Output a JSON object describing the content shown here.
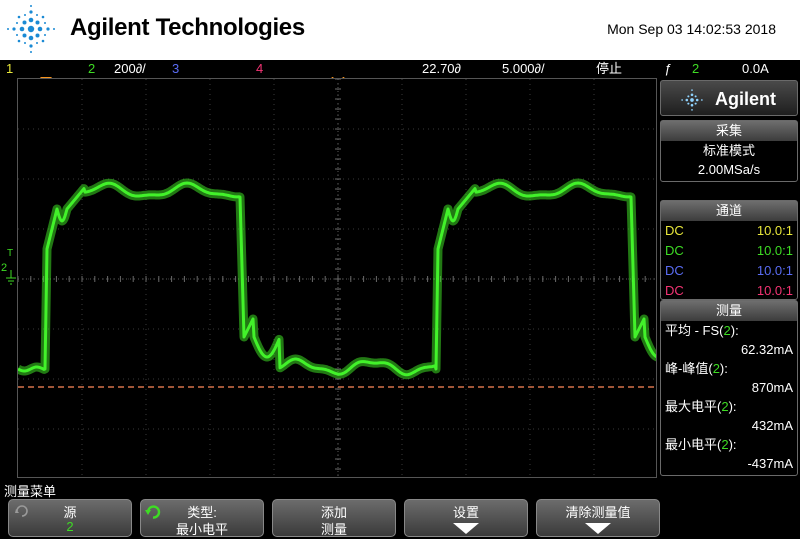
{
  "header": {
    "brand": "Agilent Technologies",
    "datetime": "Mon Sep 03 14:02:53 2018"
  },
  "statusbar": {
    "ch1": "1",
    "ch2": "2",
    "ch2_scale": "200",
    "ch2_scale_unit": "∂/",
    "ch3": "3",
    "ch4": "4",
    "time_offset": "22.70",
    "time_offset_unit": "∂",
    "time_scale": "5.000",
    "time_scale_unit": "∂/",
    "run_state": "停止",
    "trigger_symbol": "ƒ",
    "trigger_channel": "2",
    "trigger_level": "0.0A"
  },
  "colors": {
    "ch1": "#e8e83a",
    "ch2": "#3edc24",
    "ch3": "#5a6cf4",
    "ch4": "#f43474",
    "ground_ref": "#ff8a5a"
  },
  "panel": {
    "logo": "Agilent",
    "acquire": {
      "title": "采集",
      "mode": "标准模式",
      "rate": "2.00MSa/s"
    },
    "channels": {
      "title": "通道",
      "rows": [
        {
          "coupling": "DC",
          "probe": "10.0:1",
          "color": "#e8e83a"
        },
        {
          "coupling": "DC",
          "probe": "10.0:1",
          "color": "#3edc24"
        },
        {
          "coupling": "DC",
          "probe": "10.0:1",
          "color": "#5a6cf4"
        },
        {
          "coupling": "DC",
          "probe": "10.0:1",
          "color": "#f43474"
        }
      ]
    },
    "measure": {
      "title": "测量",
      "items": [
        {
          "label": "平均 - FS",
          "channel": "2",
          "value": "62.32mA"
        },
        {
          "label": "峰-峰值",
          "channel": "2",
          "value": "870mA"
        },
        {
          "label": "最大电平",
          "channel": "2",
          "value": "432mA"
        },
        {
          "label": "最小电平",
          "channel": "2",
          "value": "-437mA"
        }
      ]
    }
  },
  "menu": {
    "title": "测量菜单",
    "keys": [
      {
        "line1": "源",
        "line2": "2"
      },
      {
        "line1": "类型:",
        "line2": "最小电平"
      },
      {
        "line1": "添加",
        "line2": "测量"
      },
      {
        "line1": "设置",
        "line2": ""
      },
      {
        "line1": "清除测量值",
        "line2": ""
      }
    ]
  },
  "markers": {
    "ch2_label": "2",
    "trigger_label": "T"
  }
}
